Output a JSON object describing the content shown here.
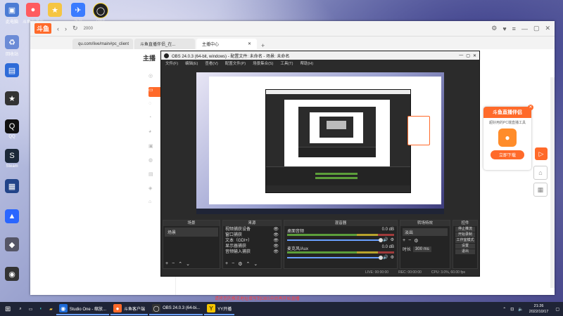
{
  "desktop": {
    "icons": [
      {
        "label": "此电脑",
        "color": "#4a7bd4",
        "glyph": "▣"
      },
      {
        "label": "斗鱼直播伴侣",
        "color": "#ff5a5f",
        "glyph": "●"
      },
      {
        "label": "",
        "color": "#f5c542",
        "glyph": "★"
      },
      {
        "label": "飞书",
        "color": "#3a7bff",
        "glyph": "✈"
      },
      {
        "label": "OBS",
        "color": "#222",
        "glyph": "◯"
      },
      {
        "label": "回收站",
        "color": "#6b8bd6",
        "glyph": "♻"
      },
      {
        "label": "",
        "color": "#2e6bd8",
        "glyph": "▤"
      },
      {
        "label": "",
        "color": "#333",
        "glyph": "★"
      },
      {
        "label": "QQ",
        "color": "#111",
        "glyph": "Q"
      },
      {
        "label": "Steam",
        "color": "#1b2838",
        "glyph": "S"
      },
      {
        "label": "",
        "color": "#224488",
        "glyph": "▦"
      },
      {
        "label": "",
        "color": "#2a66ff",
        "glyph": "▲"
      },
      {
        "label": "",
        "color": "#556",
        "glyph": "◆"
      },
      {
        "label": "",
        "color": "#333",
        "glyph": "◉"
      }
    ]
  },
  "browser": {
    "logo": "斗鱼",
    "address_short": "2000",
    "url": "qu.com/live/main#pc_client",
    "tabs": [
      "斗鱼直播伴侣_在...",
      "主播中心"
    ],
    "sidebar_title": "主播"
  },
  "obs": {
    "title": "OBS 24.0.3 (64-bit, windows) - 配置文件: 未命名 - 场景: 未命名",
    "menu": [
      "文件(F)",
      "编辑(E)",
      "查看(V)",
      "配置文件(P)",
      "场景集合(S)",
      "工具(T)",
      "帮助(H)"
    ],
    "docks": {
      "scenes": {
        "title": "场景",
        "items": [
          "场景"
        ]
      },
      "sources": {
        "title": "来源",
        "items": [
          "视频捕获设备",
          "窗口捕获",
          "文本（GDI+）",
          "显示器捕获",
          "音频输入捕获"
        ]
      },
      "mixer": {
        "title": "混音器",
        "channels": [
          {
            "name": "桌面音频",
            "db": "0.0 dB"
          },
          {
            "name": "麦克风/Aux",
            "db": "0.0 dB"
          }
        ]
      },
      "transitions": {
        "title": "转场特效",
        "type": "淡出",
        "duration_label": "时长",
        "duration": "300 ms"
      },
      "controls": {
        "title": "控件",
        "buttons": [
          "停止推流",
          "开始录制",
          "工作室模式",
          "设置",
          "退出"
        ]
      }
    },
    "status": [
      "LIVE: 00:00:00",
      "REC: 00:00:00",
      "CPU: 3.0%, 60.00 fps"
    ]
  },
  "promo": {
    "title": "斗鱼直播伴侣",
    "subtitle": "超好用的PC端直播工具",
    "button": "立即下载"
  },
  "notice_text": "请将您的推流地址填写到OBS中后再开始直播",
  "taskbar": {
    "apps": [
      {
        "label": "Studio One - 缩放...",
        "color": "#1e6bd8"
      },
      {
        "label": "斗鱼客户端",
        "color": "#ff6a2a"
      },
      {
        "label": "OBS 24.0.3 (64-bi...",
        "color": "#333"
      },
      {
        "label": "YY开播",
        "color": "#f5c400"
      }
    ],
    "time": "21:26",
    "date": "2022/10/17"
  }
}
